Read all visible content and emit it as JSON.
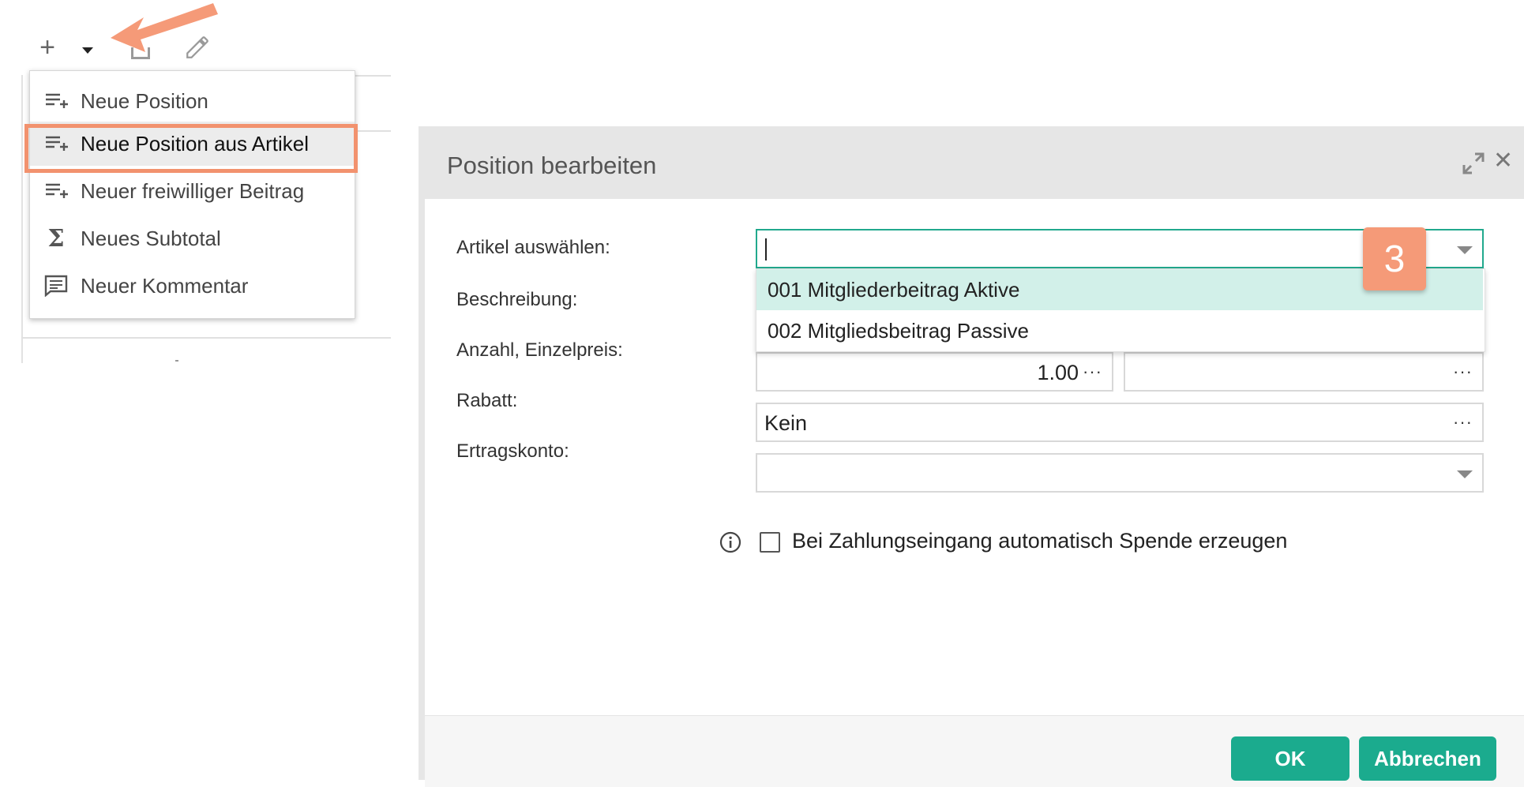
{
  "toolbar": {
    "add_icon": "plus-icon",
    "dropdown_icon": "caret-down-icon",
    "copy_icon": "copy-icon",
    "edit_icon": "pencil-icon"
  },
  "menu": {
    "items": [
      {
        "label": "Neue Position",
        "icon": "list-add-icon"
      },
      {
        "label": "Neue Position aus Artikel",
        "icon": "list-add-icon"
      },
      {
        "label": "Neuer freiwilliger Beitrag",
        "icon": "list-add-icon"
      },
      {
        "label": "Neues Subtotal",
        "icon": "sigma-icon"
      },
      {
        "label": "Neuer Kommentar",
        "icon": "comment-icon"
      }
    ],
    "selected_index": 1
  },
  "annotation": {
    "step_badge": "3",
    "highlight_color": "#f2926e",
    "arrow_color": "#f59a78"
  },
  "dialog": {
    "title": "Position bearbeiten",
    "labels": {
      "artikel": "Artikel auswählen:",
      "beschreibung": "Beschreibung:",
      "anzahl": "Anzahl, Einzelpreis:",
      "rabatt": "Rabatt:",
      "ertragskonto": "Ertragskonto:"
    },
    "artikel_value": "",
    "artikel_options": [
      "001 Mitgliederbeitrag Aktive",
      "002 Mitgliedsbeitrag Passive"
    ],
    "anzahl_value": "1.00",
    "einzelpreis_value": "",
    "rabatt_value": "Kein",
    "ertragskonto_value": "",
    "ellipsis": "···",
    "checkbox_label": "Bei Zahlungseingang automatisch Spende erzeugen",
    "checkbox_checked": false,
    "ok_label": "OK",
    "cancel_label": "Abbrechen",
    "accent_color": "#1bab8e"
  }
}
